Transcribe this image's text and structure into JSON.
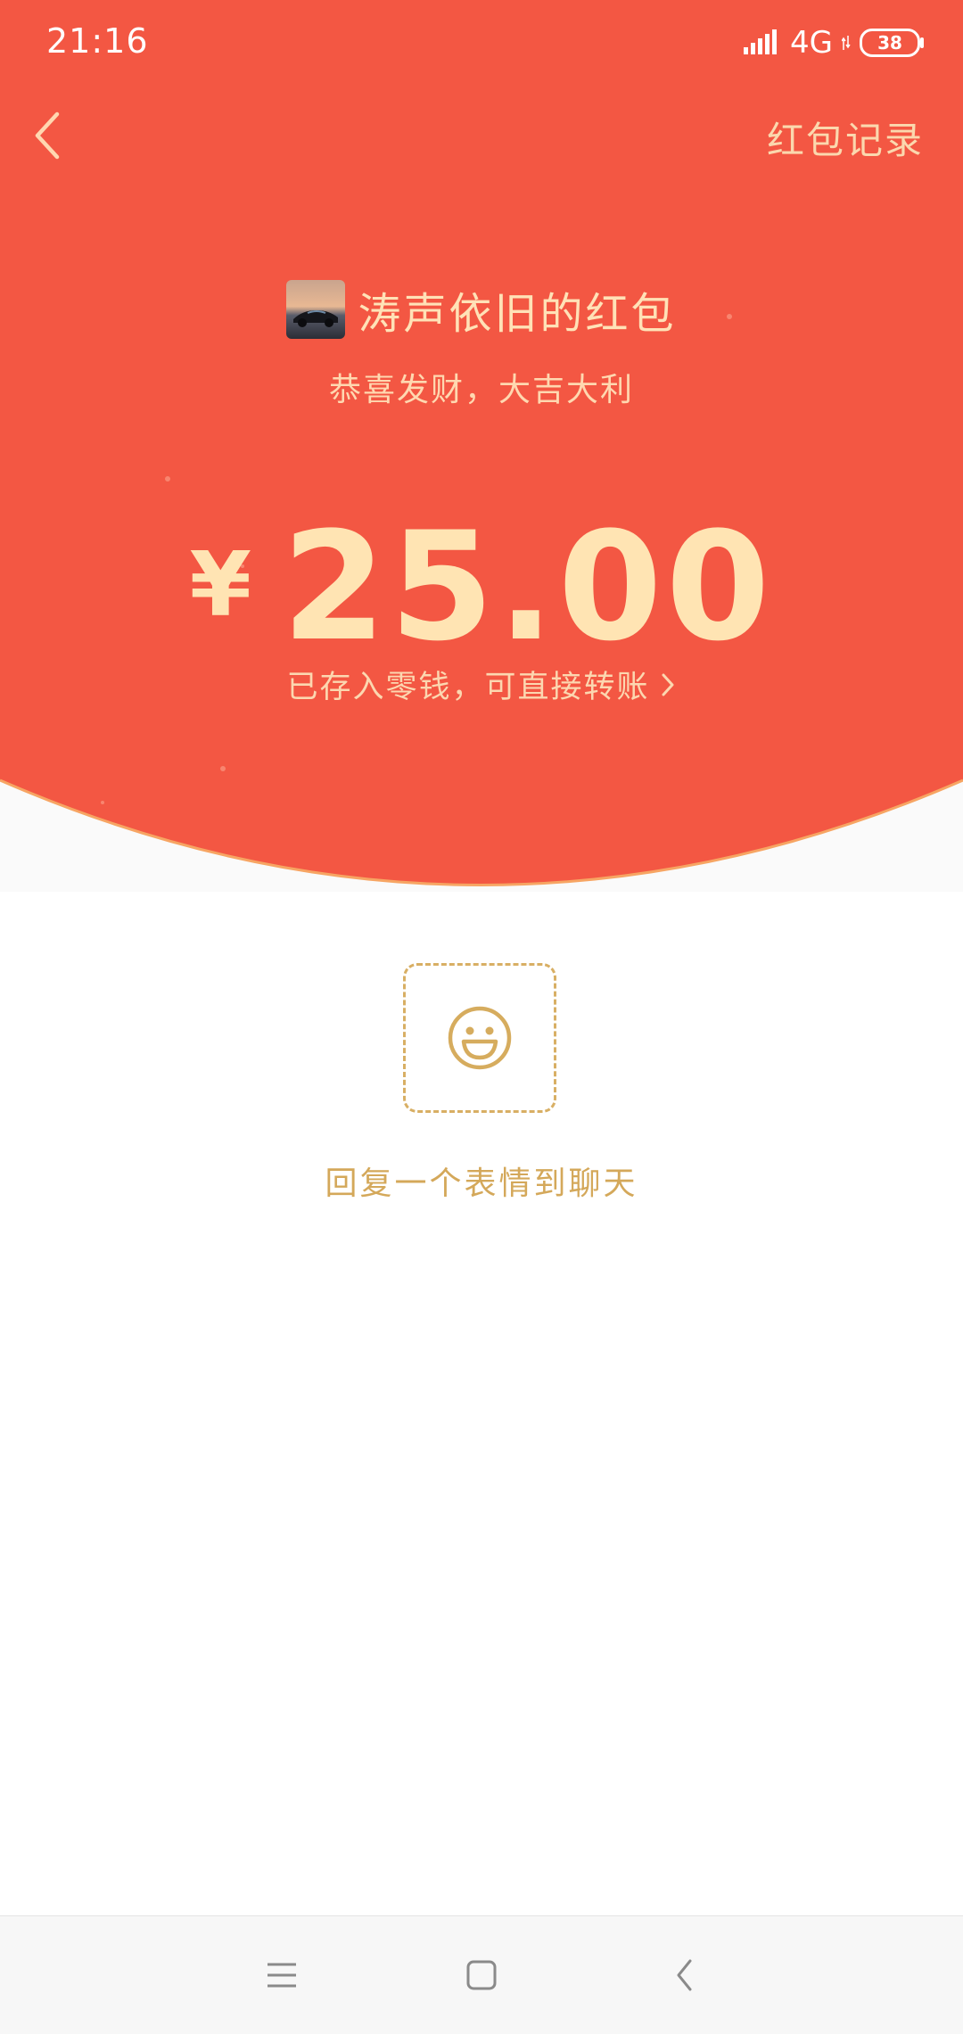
{
  "status_bar": {
    "time": "21:16",
    "network": "4G",
    "battery": "38"
  },
  "header": {
    "back_icon": "chevron-left-icon",
    "records_label": "红包记录"
  },
  "red_packet": {
    "sender_name": "涛声依旧的红包",
    "greeting": "恭喜发财，大吉大利",
    "currency": "¥",
    "amount": "25.00",
    "wallet_note": "已存入零钱，可直接转账"
  },
  "reply": {
    "icon": "smiley-icon",
    "label": "回复一个表情到聊天"
  },
  "nav_bar": {
    "menu_icon": "menu-icon",
    "home_icon": "home-square-icon",
    "back_icon": "back-chevron-icon"
  },
  "colors": {
    "hero_red": "#f35743",
    "gold_text": "#ffe4b3",
    "reply_gold": "#d4a85a"
  }
}
